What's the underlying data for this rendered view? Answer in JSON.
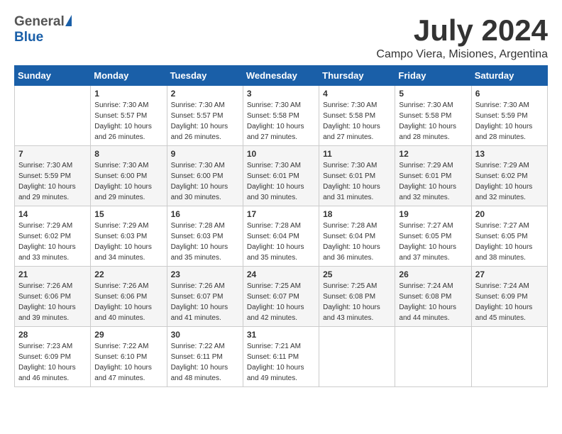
{
  "logo": {
    "general": "General",
    "blue": "Blue"
  },
  "title": {
    "month_year": "July 2024",
    "location": "Campo Viera, Misiones, Argentina"
  },
  "weekdays": [
    "Sunday",
    "Monday",
    "Tuesday",
    "Wednesday",
    "Thursday",
    "Friday",
    "Saturday"
  ],
  "weeks": [
    [
      {
        "day": "",
        "sunrise": "",
        "sunset": "",
        "daylight": ""
      },
      {
        "day": "1",
        "sunrise": "Sunrise: 7:30 AM",
        "sunset": "Sunset: 5:57 PM",
        "daylight": "Daylight: 10 hours and 26 minutes."
      },
      {
        "day": "2",
        "sunrise": "Sunrise: 7:30 AM",
        "sunset": "Sunset: 5:57 PM",
        "daylight": "Daylight: 10 hours and 26 minutes."
      },
      {
        "day": "3",
        "sunrise": "Sunrise: 7:30 AM",
        "sunset": "Sunset: 5:58 PM",
        "daylight": "Daylight: 10 hours and 27 minutes."
      },
      {
        "day": "4",
        "sunrise": "Sunrise: 7:30 AM",
        "sunset": "Sunset: 5:58 PM",
        "daylight": "Daylight: 10 hours and 27 minutes."
      },
      {
        "day": "5",
        "sunrise": "Sunrise: 7:30 AM",
        "sunset": "Sunset: 5:58 PM",
        "daylight": "Daylight: 10 hours and 28 minutes."
      },
      {
        "day": "6",
        "sunrise": "Sunrise: 7:30 AM",
        "sunset": "Sunset: 5:59 PM",
        "daylight": "Daylight: 10 hours and 28 minutes."
      }
    ],
    [
      {
        "day": "7",
        "sunrise": "Sunrise: 7:30 AM",
        "sunset": "Sunset: 5:59 PM",
        "daylight": "Daylight: 10 hours and 29 minutes."
      },
      {
        "day": "8",
        "sunrise": "Sunrise: 7:30 AM",
        "sunset": "Sunset: 6:00 PM",
        "daylight": "Daylight: 10 hours and 29 minutes."
      },
      {
        "day": "9",
        "sunrise": "Sunrise: 7:30 AM",
        "sunset": "Sunset: 6:00 PM",
        "daylight": "Daylight: 10 hours and 30 minutes."
      },
      {
        "day": "10",
        "sunrise": "Sunrise: 7:30 AM",
        "sunset": "Sunset: 6:01 PM",
        "daylight": "Daylight: 10 hours and 30 minutes."
      },
      {
        "day": "11",
        "sunrise": "Sunrise: 7:30 AM",
        "sunset": "Sunset: 6:01 PM",
        "daylight": "Daylight: 10 hours and 31 minutes."
      },
      {
        "day": "12",
        "sunrise": "Sunrise: 7:29 AM",
        "sunset": "Sunset: 6:01 PM",
        "daylight": "Daylight: 10 hours and 32 minutes."
      },
      {
        "day": "13",
        "sunrise": "Sunrise: 7:29 AM",
        "sunset": "Sunset: 6:02 PM",
        "daylight": "Daylight: 10 hours and 32 minutes."
      }
    ],
    [
      {
        "day": "14",
        "sunrise": "Sunrise: 7:29 AM",
        "sunset": "Sunset: 6:02 PM",
        "daylight": "Daylight: 10 hours and 33 minutes."
      },
      {
        "day": "15",
        "sunrise": "Sunrise: 7:29 AM",
        "sunset": "Sunset: 6:03 PM",
        "daylight": "Daylight: 10 hours and 34 minutes."
      },
      {
        "day": "16",
        "sunrise": "Sunrise: 7:28 AM",
        "sunset": "Sunset: 6:03 PM",
        "daylight": "Daylight: 10 hours and 35 minutes."
      },
      {
        "day": "17",
        "sunrise": "Sunrise: 7:28 AM",
        "sunset": "Sunset: 6:04 PM",
        "daylight": "Daylight: 10 hours and 35 minutes."
      },
      {
        "day": "18",
        "sunrise": "Sunrise: 7:28 AM",
        "sunset": "Sunset: 6:04 PM",
        "daylight": "Daylight: 10 hours and 36 minutes."
      },
      {
        "day": "19",
        "sunrise": "Sunrise: 7:27 AM",
        "sunset": "Sunset: 6:05 PM",
        "daylight": "Daylight: 10 hours and 37 minutes."
      },
      {
        "day": "20",
        "sunrise": "Sunrise: 7:27 AM",
        "sunset": "Sunset: 6:05 PM",
        "daylight": "Daylight: 10 hours and 38 minutes."
      }
    ],
    [
      {
        "day": "21",
        "sunrise": "Sunrise: 7:26 AM",
        "sunset": "Sunset: 6:06 PM",
        "daylight": "Daylight: 10 hours and 39 minutes."
      },
      {
        "day": "22",
        "sunrise": "Sunrise: 7:26 AM",
        "sunset": "Sunset: 6:06 PM",
        "daylight": "Daylight: 10 hours and 40 minutes."
      },
      {
        "day": "23",
        "sunrise": "Sunrise: 7:26 AM",
        "sunset": "Sunset: 6:07 PM",
        "daylight": "Daylight: 10 hours and 41 minutes."
      },
      {
        "day": "24",
        "sunrise": "Sunrise: 7:25 AM",
        "sunset": "Sunset: 6:07 PM",
        "daylight": "Daylight: 10 hours and 42 minutes."
      },
      {
        "day": "25",
        "sunrise": "Sunrise: 7:25 AM",
        "sunset": "Sunset: 6:08 PM",
        "daylight": "Daylight: 10 hours and 43 minutes."
      },
      {
        "day": "26",
        "sunrise": "Sunrise: 7:24 AM",
        "sunset": "Sunset: 6:08 PM",
        "daylight": "Daylight: 10 hours and 44 minutes."
      },
      {
        "day": "27",
        "sunrise": "Sunrise: 7:24 AM",
        "sunset": "Sunset: 6:09 PM",
        "daylight": "Daylight: 10 hours and 45 minutes."
      }
    ],
    [
      {
        "day": "28",
        "sunrise": "Sunrise: 7:23 AM",
        "sunset": "Sunset: 6:09 PM",
        "daylight": "Daylight: 10 hours and 46 minutes."
      },
      {
        "day": "29",
        "sunrise": "Sunrise: 7:22 AM",
        "sunset": "Sunset: 6:10 PM",
        "daylight": "Daylight: 10 hours and 47 minutes."
      },
      {
        "day": "30",
        "sunrise": "Sunrise: 7:22 AM",
        "sunset": "Sunset: 6:11 PM",
        "daylight": "Daylight: 10 hours and 48 minutes."
      },
      {
        "day": "31",
        "sunrise": "Sunrise: 7:21 AM",
        "sunset": "Sunset: 6:11 PM",
        "daylight": "Daylight: 10 hours and 49 minutes."
      },
      {
        "day": "",
        "sunrise": "",
        "sunset": "",
        "daylight": ""
      },
      {
        "day": "",
        "sunrise": "",
        "sunset": "",
        "daylight": ""
      },
      {
        "day": "",
        "sunrise": "",
        "sunset": "",
        "daylight": ""
      }
    ]
  ]
}
